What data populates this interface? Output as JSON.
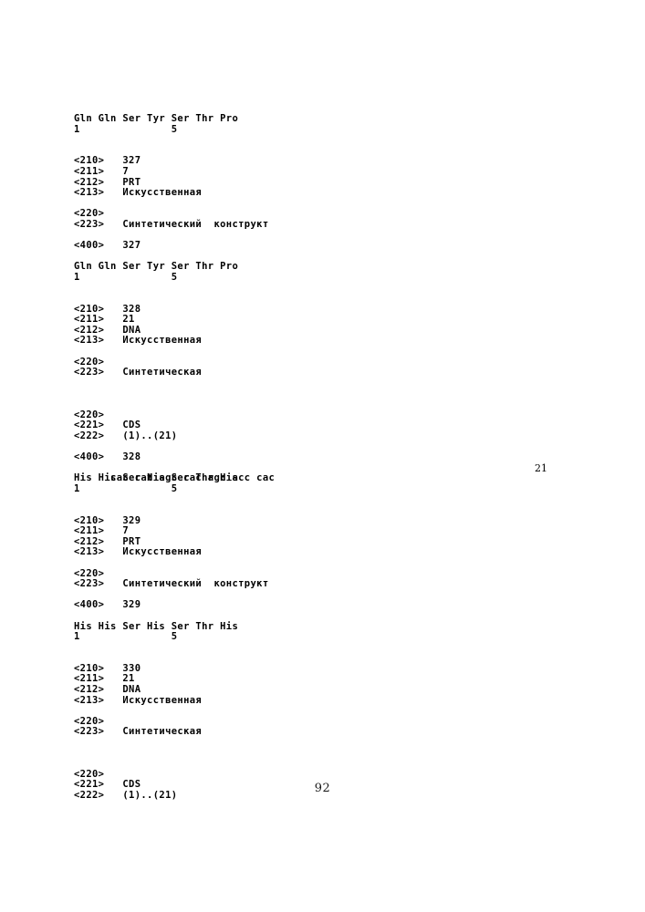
{
  "document": {
    "type": "patent-sequence-listing",
    "page_number": "92",
    "language_note": "Russian",
    "background_color": "#ffffff",
    "text_color": "#000000"
  },
  "lines": [
    {
      "id": "l01",
      "kind": "sequence",
      "text": "Gln Gln Ser Tyr Ser Thr Pro"
    },
    {
      "id": "l02",
      "kind": "numbering",
      "text": "1               5"
    },
    {
      "id": "l03",
      "kind": "field",
      "text": "<210>   327"
    },
    {
      "id": "l04",
      "kind": "field",
      "text": "<211>   7"
    },
    {
      "id": "l05",
      "kind": "field",
      "text": "<212>   PRT"
    },
    {
      "id": "l06",
      "kind": "field",
      "text": "<213>   Искусственная"
    },
    {
      "id": "l07",
      "kind": "field",
      "text": "<220>"
    },
    {
      "id": "l08",
      "kind": "field",
      "text": "<223>   Синтетический  конструкт"
    },
    {
      "id": "l09",
      "kind": "field",
      "text": "<400>   327"
    },
    {
      "id": "l10",
      "kind": "sequence",
      "text": "Gln Gln Ser Tyr Ser Thr Pro"
    },
    {
      "id": "l11",
      "kind": "numbering",
      "text": "1               5"
    },
    {
      "id": "l12",
      "kind": "field",
      "text": "<210>   328"
    },
    {
      "id": "l13",
      "kind": "field",
      "text": "<211>   21"
    },
    {
      "id": "l14",
      "kind": "field",
      "text": "<212>   DNA"
    },
    {
      "id": "l15",
      "kind": "field",
      "text": "<213>   Искусственная"
    },
    {
      "id": "l16",
      "kind": "field",
      "text": "<220>"
    },
    {
      "id": "l17",
      "kind": "field",
      "text": "<223>   Синтетическая"
    },
    {
      "id": "l18",
      "kind": "field",
      "text": "<220>"
    },
    {
      "id": "l19",
      "kind": "field",
      "text": "<221>   CDS"
    },
    {
      "id": "l20",
      "kind": "field",
      "text": "<222>   (1)..(21)"
    },
    {
      "id": "l21",
      "kind": "field",
      "text": "<400>   328"
    },
    {
      "id": "l22",
      "kind": "codon",
      "text": "cac cat agc cac agc acc cac",
      "right_marker": "21"
    },
    {
      "id": "l23",
      "kind": "sequence",
      "text": "His His Ser His Ser Thr His"
    },
    {
      "id": "l24",
      "kind": "numbering",
      "text": "1               5"
    },
    {
      "id": "l25",
      "kind": "field",
      "text": "<210>   329"
    },
    {
      "id": "l26",
      "kind": "field",
      "text": "<211>   7"
    },
    {
      "id": "l27",
      "kind": "field",
      "text": "<212>   PRT"
    },
    {
      "id": "l28",
      "kind": "field",
      "text": "<213>   Искусственная"
    },
    {
      "id": "l29",
      "kind": "field",
      "text": "<220>"
    },
    {
      "id": "l30",
      "kind": "field",
      "text": "<223>   Синтетический  конструкт"
    },
    {
      "id": "l31",
      "kind": "field",
      "text": "<400>   329"
    },
    {
      "id": "l32",
      "kind": "sequence",
      "text": "His His Ser His Ser Thr His"
    },
    {
      "id": "l33",
      "kind": "numbering",
      "text": "1               5"
    },
    {
      "id": "l34",
      "kind": "field",
      "text": "<210>   330"
    },
    {
      "id": "l35",
      "kind": "field",
      "text": "<211>   21"
    },
    {
      "id": "l36",
      "kind": "field",
      "text": "<212>   DNA"
    },
    {
      "id": "l37",
      "kind": "field",
      "text": "<213>   Искусственная"
    },
    {
      "id": "l38",
      "kind": "field",
      "text": "<220>"
    },
    {
      "id": "l39",
      "kind": "field",
      "text": "<223>   Синтетическая"
    },
    {
      "id": "l40",
      "kind": "field",
      "text": "<220>"
    },
    {
      "id": "l41",
      "kind": "field",
      "text": "<221>   CDS"
    },
    {
      "id": "l42",
      "kind": "field",
      "text": "<222>   (1)..(21)"
    }
  ]
}
